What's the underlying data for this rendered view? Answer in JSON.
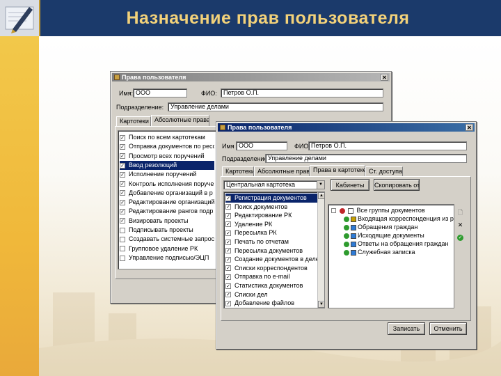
{
  "slide": {
    "title": "Назначение прав пользователя"
  },
  "back_window": {
    "title": "Права пользователя",
    "name_label": "Имя:",
    "name_value": "ООО",
    "fio_label": "ФИО:",
    "fio_value": "Петров О.П.",
    "dept_label": "Подразделение:",
    "dept_value": "Управление делами",
    "tabs": [
      "Картотеки",
      "Абсолютные права"
    ],
    "rights": [
      {
        "label": "Поиск по всем картотекам",
        "checked": true,
        "selected": false
      },
      {
        "label": "Отправка документов по ресс",
        "checked": true,
        "selected": false
      },
      {
        "label": "Просмотр всех поручений",
        "checked": true,
        "selected": false
      },
      {
        "label": "Ввод резолюций",
        "checked": true,
        "selected": true
      },
      {
        "label": "Исполнение поручений",
        "checked": true,
        "selected": false
      },
      {
        "label": "Контроль исполнения поруче",
        "checked": true,
        "selected": false
      },
      {
        "label": "Добавление организаций в р",
        "checked": true,
        "selected": false
      },
      {
        "label": "Редактирование организаций",
        "checked": true,
        "selected": false
      },
      {
        "label": "Редактирование рангов подр",
        "checked": true,
        "selected": false
      },
      {
        "label": "Визировать проекты",
        "checked": true,
        "selected": false
      },
      {
        "label": "Подписывать проекты",
        "checked": false,
        "selected": false
      },
      {
        "label": "Создавать системные запрос",
        "checked": false,
        "selected": false
      },
      {
        "label": "Групповое удаление РК",
        "checked": false,
        "selected": false
      },
      {
        "label": "Управление подписью/ЭЦП",
        "checked": false,
        "selected": false
      }
    ]
  },
  "front_window": {
    "title": "Права пользователя",
    "name_label": "Имя",
    "name_value": "ООО",
    "fio_label": "ФИО",
    "fio_value": "Петров О.П.",
    "dept_label": "Подразделение",
    "dept_value": "Управление делами",
    "tabs": [
      "Картотеки",
      "Абсолютные права",
      "Права в картотеке",
      "Ст. доступа"
    ],
    "combo_value": "Центральная картотека",
    "cabinets_button": "Кабинеты",
    "copy_button": "Скопировать от...",
    "rights": [
      {
        "label": "Регистрация документов",
        "checked": true,
        "selected": true
      },
      {
        "label": "Поиск документов",
        "checked": true,
        "selected": false
      },
      {
        "label": "Редактирование РК",
        "checked": true,
        "selected": false
      },
      {
        "label": "Удаление РК",
        "checked": true,
        "selected": false
      },
      {
        "label": "Пересылка РК",
        "checked": true,
        "selected": false
      },
      {
        "label": "Печать по отчетам",
        "checked": true,
        "selected": false
      },
      {
        "label": "Пересылка документов",
        "checked": true,
        "selected": false
      },
      {
        "label": "Создание документов в деле",
        "checked": true,
        "selected": false
      },
      {
        "label": "Списки корреспондентов",
        "checked": true,
        "selected": false
      },
      {
        "label": "Отправка по e-mail",
        "checked": true,
        "selected": false
      },
      {
        "label": "Статистика документов",
        "checked": true,
        "selected": false
      },
      {
        "label": "Списки дел",
        "checked": true,
        "selected": false
      },
      {
        "label": "Добавление файлов",
        "checked": true,
        "selected": false
      }
    ],
    "tree_root": "Все группы документов",
    "tree_items": [
      "Входящая корреспонденция из ра",
      "Обращения граждан",
      "Исходящие документы",
      "Ответы на обращения граждан",
      "Служебная записка"
    ],
    "ok_button": "Записать",
    "cancel_button": "Отменить"
  },
  "colors": {
    "header": "#1b3a6b",
    "title_text": "#f3d27a",
    "side_strip": "#f0b83a",
    "selection": "#0a246a"
  }
}
